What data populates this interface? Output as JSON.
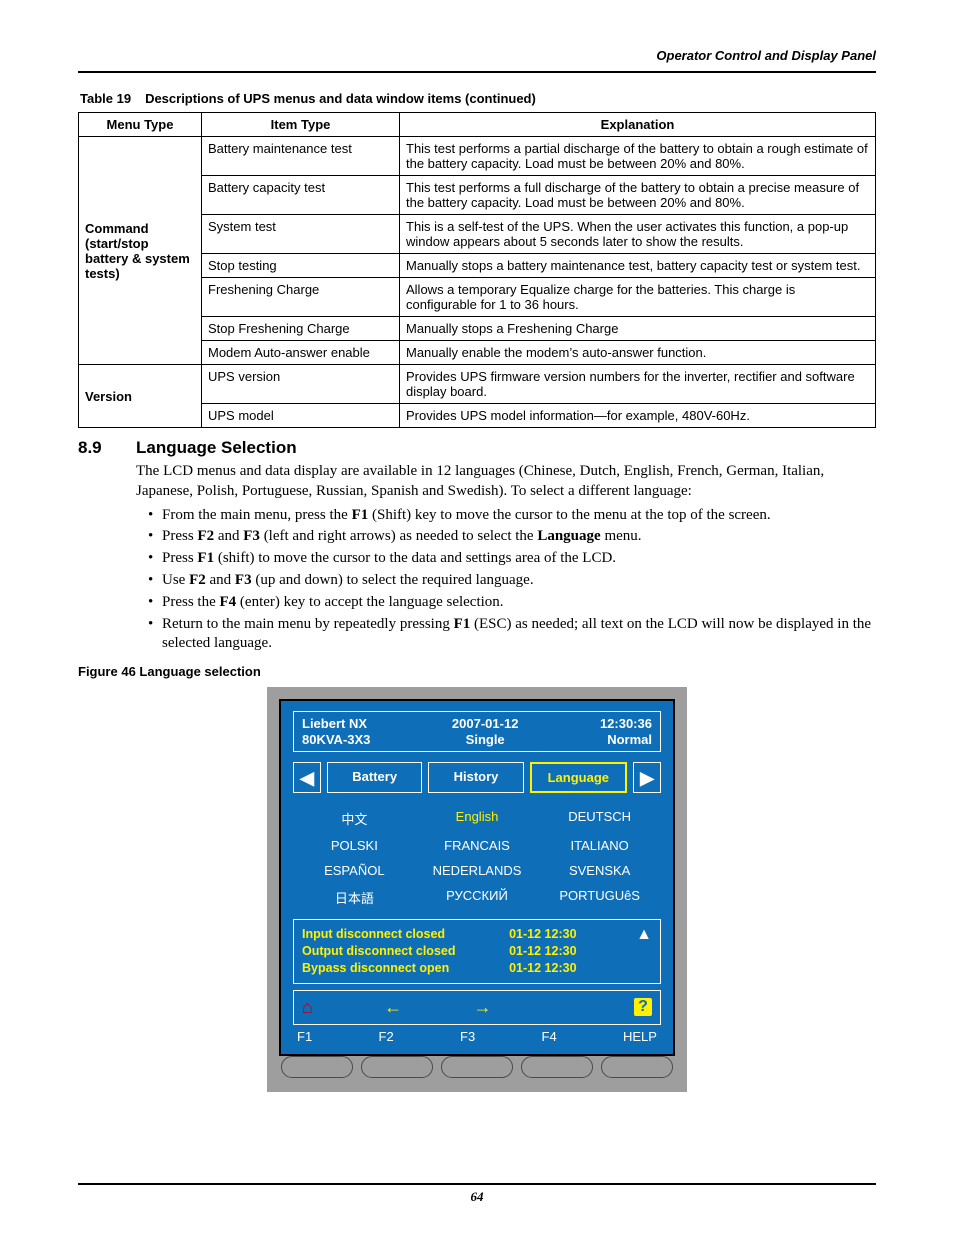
{
  "running_head": "Operator Control and Display Panel",
  "table": {
    "caption_num": "Table 19",
    "caption_text": "Descriptions of UPS menus and data window items (continued)",
    "headers": [
      "Menu Type",
      "Item Type",
      "Explanation"
    ],
    "group1_menu": "Command (start/stop battery & system tests)",
    "group2_menu": "Version",
    "rows1": [
      {
        "item": "Battery maintenance test",
        "exp": "This test performs a partial discharge of the battery to obtain a rough estimate of the battery capacity. Load must be between 20% and 80%."
      },
      {
        "item": "Battery capacity test",
        "exp": "This test performs a full discharge of the battery to obtain a precise measure of the battery capacity. Load must be between 20% and 80%."
      },
      {
        "item": "System test",
        "exp": "This is a self-test of the UPS. When the user activates this function, a pop-up window appears about 5 seconds later to show the results."
      },
      {
        "item": "Stop testing",
        "exp": "Manually stops a battery maintenance test, battery capacity test or system test."
      },
      {
        "item": "Freshening Charge",
        "exp": "Allows a temporary Equalize charge for the batteries. This charge is configurable for 1 to 36 hours."
      },
      {
        "item": "Stop Freshening Charge",
        "exp": "Manually stops a Freshening Charge"
      },
      {
        "item": "Modem Auto-answer enable",
        "exp": "Manually enable the modem’s auto-answer function."
      }
    ],
    "rows2": [
      {
        "item": "UPS version",
        "exp": "Provides UPS firmware version numbers for the inverter, rectifier and software display board."
      },
      {
        "item": "UPS model",
        "exp": "Provides UPS model information—for example, 480V-60Hz."
      }
    ]
  },
  "section": {
    "num": "8.9",
    "title": "Language Selection",
    "intro": "The LCD menus and data display are available in 12 languages (Chinese, Dutch, English, French, German, Italian, Japanese, Polish, Portuguese, Russian, Spanish and Swedish). To select a different language:",
    "bullets": [
      [
        "From the main menu, press the ",
        "F1",
        " (Shift) key to move the cursor to the menu at the top of the screen."
      ],
      [
        "Press ",
        "F2",
        " and ",
        "F3",
        " (left and right arrows) as needed to select the ",
        "Language",
        " menu."
      ],
      [
        "Press ",
        "F1",
        " (shift) to move the cursor to the data and settings area of the LCD."
      ],
      [
        "Use ",
        "F2",
        " and ",
        "F3",
        " (up and down) to select the required language."
      ],
      [
        "Press the ",
        "F4",
        " (enter) key to accept the language selection."
      ],
      [
        "Return to the main menu by repeatedly pressing ",
        "F1",
        " (ESC) as needed; all text on the LCD will now be displayed in the selected language."
      ]
    ]
  },
  "figure_caption": "Figure 46  Language selection",
  "screen": {
    "header_left": [
      "Liebert NX",
      "80KVA-3X3"
    ],
    "header_center": [
      "2007-01-12",
      "Single"
    ],
    "header_right": [
      "12:30:36",
      "Normal"
    ],
    "tabs": [
      "Battery",
      "History",
      "Language"
    ],
    "langs": [
      "中文",
      "English",
      "DEUTSCH",
      "POLSKI",
      "FRANCAIS",
      "ITALIANO",
      "ESPAÑOL",
      "NEDERLANDS",
      "SVENSKA",
      "日本語",
      "РУССКИЙ",
      "PORTUGUêS"
    ],
    "log": [
      {
        "t": "Input disconnect closed",
        "d": "01-12 12:30"
      },
      {
        "t": "Output disconnect closed",
        "d": "01-12 12:30"
      },
      {
        "t": "Bypass disconnect open",
        "d": "01-12 12:30"
      }
    ],
    "keys": [
      "F1",
      "F2",
      "F3",
      "F4",
      "HELP"
    ]
  },
  "page_number": "64"
}
